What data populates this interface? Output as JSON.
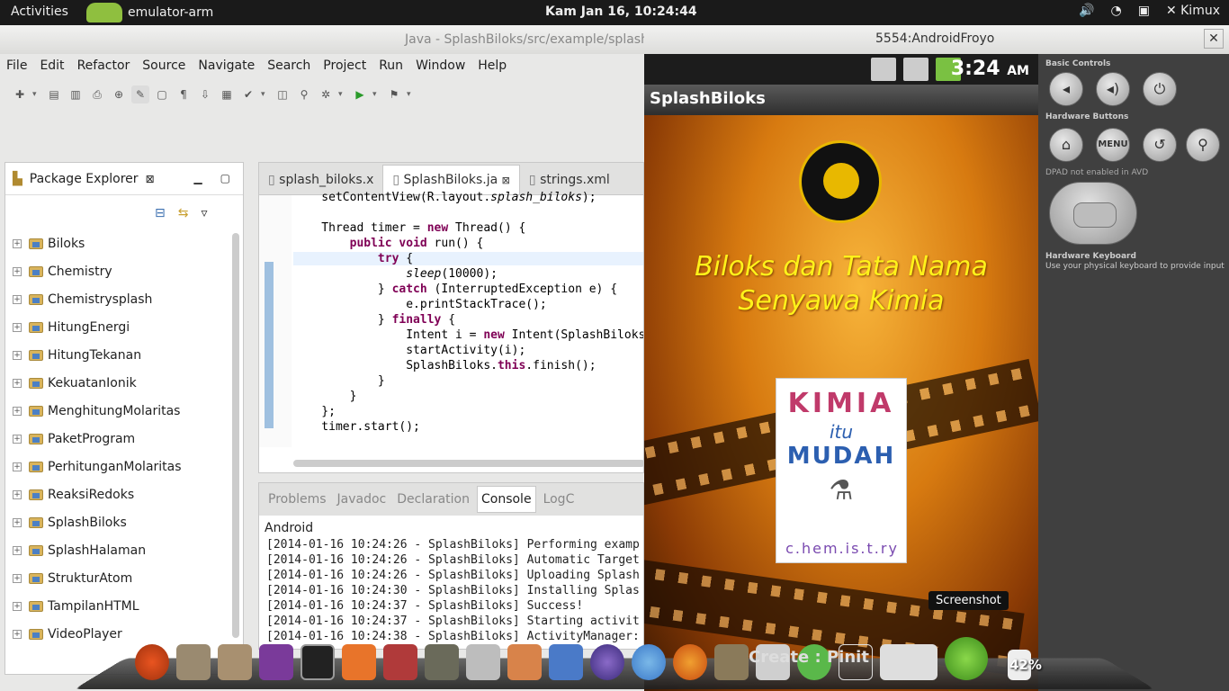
{
  "topbar": {
    "activities": "Activities",
    "app_name": "emulator-arm",
    "clock": "Kam Jan 16, 10:24:44",
    "user": "Kimux"
  },
  "eclipse": {
    "title": "Java - SplashBiloks/src/example/splash",
    "menu": [
      "File",
      "Edit",
      "Refactor",
      "Source",
      "Navigate",
      "Search",
      "Project",
      "Run",
      "Window",
      "Help"
    ],
    "package_explorer": {
      "title": "Package Explorer",
      "projects": [
        "Biloks",
        "Chemistry",
        "Chemistrysplash",
        "HitungEnergi",
        "HitungTekanan",
        "KekuatanIonik",
        "MenghitungMolaritas",
        "PaketProgram",
        "PerhitunganMolaritas",
        "ReaksiRedoks",
        "SplashBiloks",
        "SplashHalaman",
        "StrukturAtom",
        "TampilanHTML",
        "VideoPlayer"
      ]
    },
    "editor": {
      "tabs": [
        "splash_biloks.x",
        "SplashBiloks.ja",
        "strings.xml"
      ],
      "active_tab": 1
    },
    "console": {
      "tabs": [
        "Problems",
        "Javadoc",
        "Declaration",
        "Console",
        "LogC"
      ],
      "active_tab": 3,
      "label": "Android",
      "lines": [
        "[2014-01-16 10:24:26 - SplashBiloks] Performing examp",
        "[2014-01-16 10:24:26 - SplashBiloks] Automatic Target",
        "[2014-01-16 10:24:26 - SplashBiloks] Uploading Splash",
        "[2014-01-16 10:24:30 - SplashBiloks] Installing Splas",
        "[2014-01-16 10:24:37 - SplashBiloks] Success!",
        "[2014-01-16 10:24:37 - SplashBiloks] Starting activit",
        "[2014-01-16 10:24:38 - SplashBiloks] ActivityManager:"
      ]
    }
  },
  "emulator": {
    "title": "5554:AndroidFroyo",
    "time": "3:24",
    "ampm": "AM",
    "app_title": "SplashBiloks",
    "headline_1": "Biloks dan Tata Nama",
    "headline_2": "Senyawa Kimia",
    "book_kimia": "KIMIA",
    "book_itu": "itu",
    "book_mudah": "MUDAH",
    "book_chemistry": "c.hem.is.t.ry",
    "controls": {
      "basic": "Basic Controls",
      "hardware": "Hardware Buttons",
      "menu": "MENU",
      "dpad": "DPAD not enabled in AVD",
      "keyboard_title": "Hardware Keyboard",
      "keyboard_desc": "Use your physical keyboard to provide input"
    }
  },
  "dock": {
    "tooltip": "Screenshot",
    "battery": "42%",
    "pin_text": "Create : Pinit"
  }
}
